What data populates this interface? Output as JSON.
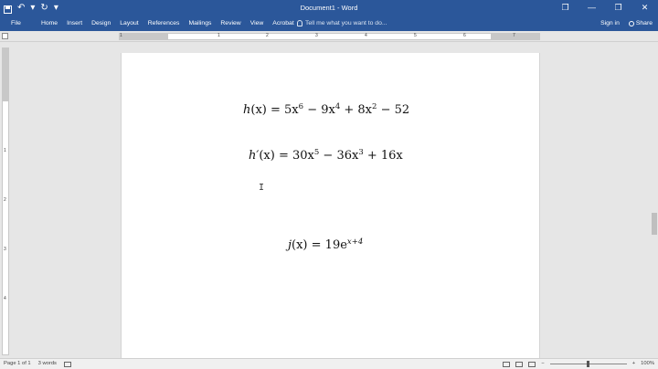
{
  "window": {
    "title": "Document1 - Word",
    "controls": [
      "❐",
      "—",
      "❐",
      "✕"
    ]
  },
  "qat": {
    "undo_glyph": "↶",
    "undo_drop": "▾",
    "redo_glyph": "↻",
    "customize_glyph": "▾"
  },
  "ribbon": {
    "tabs": [
      "File",
      "Home",
      "Insert",
      "Design",
      "Layout",
      "References",
      "Mailings",
      "Review",
      "View",
      "Acrobat"
    ],
    "tell_me": "Tell me what you want to do...",
    "sign_in": "Sign in",
    "share": "Share"
  },
  "ruler": {
    "numbers": [
      "1",
      "1",
      "2",
      "3",
      "4",
      "5",
      "6",
      "7"
    ],
    "vnumbers": [
      "1",
      "2",
      "3",
      "4"
    ]
  },
  "document": {
    "equations": [
      {
        "lhs": "h",
        "arg": "(x)",
        "rhs": "= 5x",
        "p1": "6",
        "t2": " − 9x",
        "p2": "4",
        "t3": " + 8x",
        "p3": "2",
        "t4": " − 52"
      },
      {
        "lhs": "h′",
        "arg": "(x)",
        "rhs": "= 30x",
        "p1": "5",
        "t2": " − 36x",
        "p2": "3",
        "t3": " + 16x"
      },
      {
        "lhs": "j",
        "arg": "(x)",
        "rhs": "= 19e",
        "p1": "x+4"
      }
    ],
    "cursor_glyph": "I"
  },
  "status": {
    "page": "Page 1 of 1",
    "words": "3 words",
    "zoom": "100%",
    "minus": "−",
    "plus": "+"
  },
  "colors": {
    "ribbon_blue": "#2b579a",
    "page": "#ffffff",
    "canvas": "#e6e6e6"
  }
}
